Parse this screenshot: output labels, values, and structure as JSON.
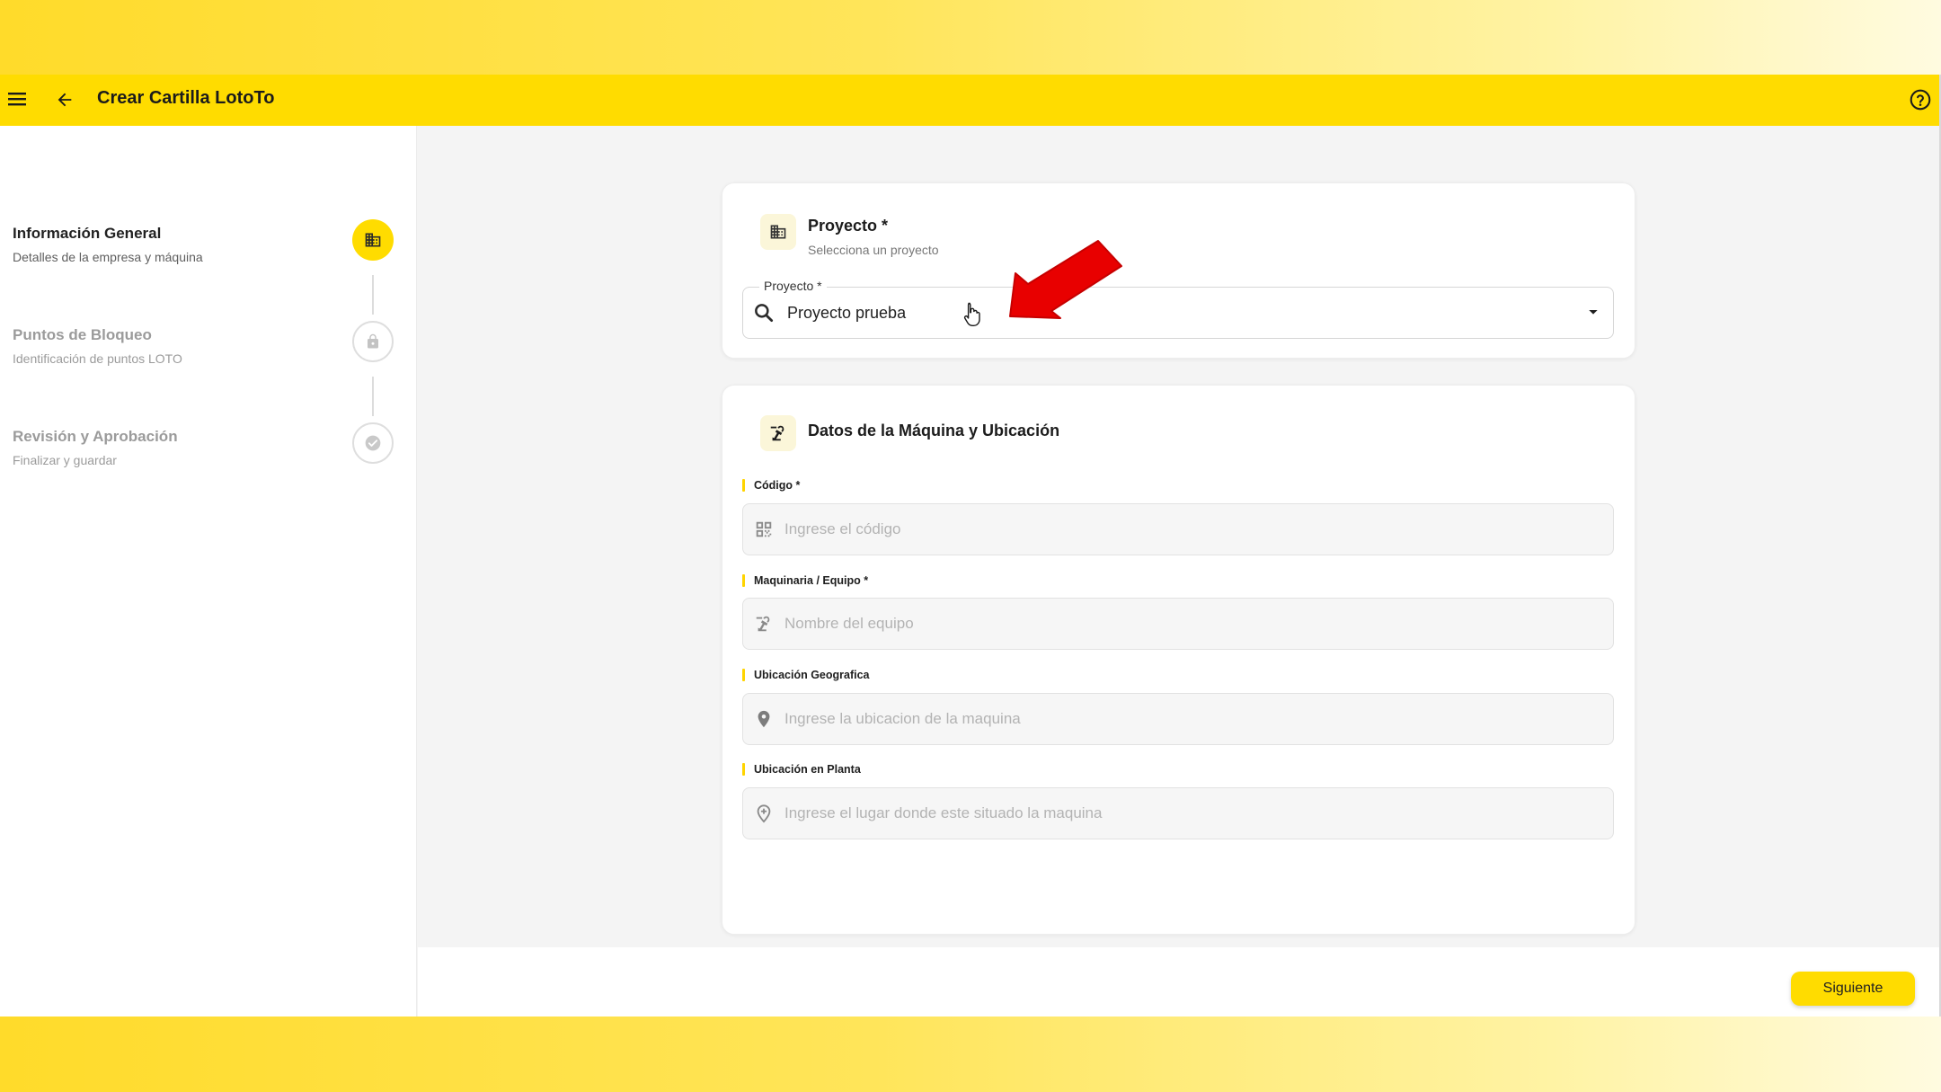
{
  "header": {
    "title": "Crear Cartilla LotoTo",
    "menu_icon": "menu-icon",
    "back_icon": "arrow-left-icon",
    "help_icon": "help-circle-icon",
    "color": "#ffdc00"
  },
  "steps": [
    {
      "title": "Información General",
      "subtitle": "Detalles de la empresa y máquina",
      "icon": "building-icon",
      "state": "active"
    },
    {
      "title": "Puntos de Bloqueo",
      "subtitle": "Identificación de puntos LOTO",
      "icon": "lock-icon",
      "state": "inactive"
    },
    {
      "title": "Revisión y Aprobación",
      "subtitle": "Finalizar y guardar",
      "icon": "check-circle-icon",
      "state": "inactive"
    }
  ],
  "project_card": {
    "title": "Proyecto *",
    "subtitle": "Selecciona un proyecto",
    "field_label": "Proyecto *",
    "field_value": "Proyecto prueba"
  },
  "machine_card": {
    "title": "Datos de la Máquina y Ubicación",
    "fields": [
      {
        "label": "Código *",
        "placeholder": "Ingrese el código",
        "icon": "qr-code-icon"
      },
      {
        "label": "Maquinaria / Equipo *",
        "placeholder": "Nombre del equipo",
        "icon": "precision-machine-icon"
      },
      {
        "label": "Ubicación Geografica",
        "placeholder": "Ingrese la ubicacion de la maquina",
        "icon": "map-pin-icon"
      },
      {
        "label": "Ubicación en Planta",
        "placeholder": "Ingrese el lugar donde este situado la maquina",
        "icon": "location-outline-icon"
      }
    ]
  },
  "footer": {
    "next_label": "Siguiente"
  },
  "annotation": {
    "arrow_color": "#e80000"
  }
}
